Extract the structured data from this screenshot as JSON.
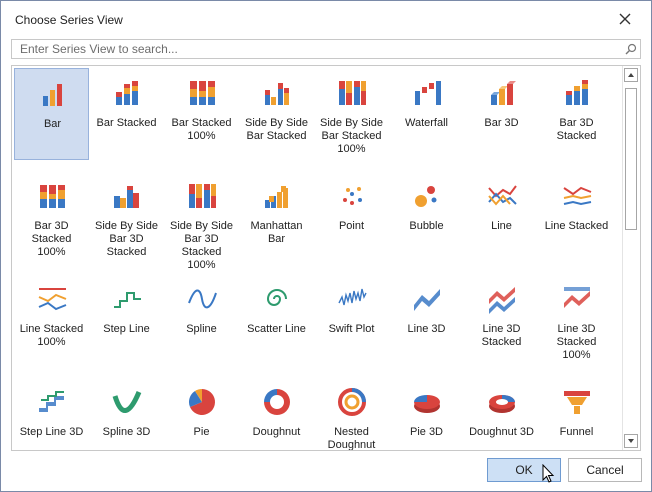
{
  "dialog": {
    "title": "Choose Series View",
    "search_placeholder": "Enter Series View to search...",
    "ok_label": "OK",
    "cancel_label": "Cancel"
  },
  "gallery": {
    "selected": "Bar",
    "items": [
      {
        "label": "Bar",
        "icon": "bar-icon"
      },
      {
        "label": "Bar Stacked",
        "icon": "bar-stacked-icon"
      },
      {
        "label": "Bar Stacked\n100%",
        "icon": "bar-stacked-100-icon"
      },
      {
        "label": "Side By Side\nBar Stacked",
        "icon": "side-by-side-bar-stacked-icon"
      },
      {
        "label": "Side By Side\nBar Stacked\n100%",
        "icon": "side-by-side-bar-stacked-100-icon"
      },
      {
        "label": "Waterfall",
        "icon": "waterfall-icon"
      },
      {
        "label": "Bar 3D",
        "icon": "bar-3d-icon"
      },
      {
        "label": "Bar 3D\nStacked",
        "icon": "bar-3d-stacked-icon"
      },
      {
        "label": "Bar 3D\nStacked\n100%",
        "icon": "bar-3d-stacked-100-icon"
      },
      {
        "label": "Side By Side\nBar 3D\nStacked",
        "icon": "side-by-side-bar-3d-stacked-icon"
      },
      {
        "label": "Side By Side\nBar 3D\nStacked\n100%",
        "icon": "side-by-side-bar-3d-stacked-100-icon"
      },
      {
        "label": "Manhattan\nBar",
        "icon": "manhattan-bar-icon"
      },
      {
        "label": "Point",
        "icon": "point-icon"
      },
      {
        "label": "Bubble",
        "icon": "bubble-icon"
      },
      {
        "label": "Line",
        "icon": "line-icon"
      },
      {
        "label": "Line Stacked",
        "icon": "line-stacked-icon"
      },
      {
        "label": "Line Stacked\n100%",
        "icon": "line-stacked-100-icon"
      },
      {
        "label": "Step Line",
        "icon": "step-line-icon"
      },
      {
        "label": "Spline",
        "icon": "spline-icon"
      },
      {
        "label": "Scatter Line",
        "icon": "scatter-line-icon"
      },
      {
        "label": "Swift Plot",
        "icon": "swift-plot-icon"
      },
      {
        "label": "Line 3D",
        "icon": "line-3d-icon"
      },
      {
        "label": "Line 3D\nStacked",
        "icon": "line-3d-stacked-icon"
      },
      {
        "label": "Line 3D\nStacked\n100%",
        "icon": "line-3d-stacked-100-icon"
      },
      {
        "label": "Step Line 3D",
        "icon": "step-line-3d-icon"
      },
      {
        "label": "Spline 3D",
        "icon": "spline-3d-icon"
      },
      {
        "label": "Pie",
        "icon": "pie-icon"
      },
      {
        "label": "Doughnut",
        "icon": "doughnut-icon"
      },
      {
        "label": "Nested\nDoughnut",
        "icon": "nested-doughnut-icon"
      },
      {
        "label": "Pie 3D",
        "icon": "pie-3d-icon"
      },
      {
        "label": "Doughnut 3D",
        "icon": "doughnut-3d-icon"
      },
      {
        "label": "Funnel",
        "icon": "funnel-icon"
      }
    ]
  },
  "colors": {
    "red": "#d9443e",
    "blue": "#3a78c4",
    "orange": "#f0a030",
    "green": "#2e9b6e",
    "selection": "#cfdcf0"
  }
}
